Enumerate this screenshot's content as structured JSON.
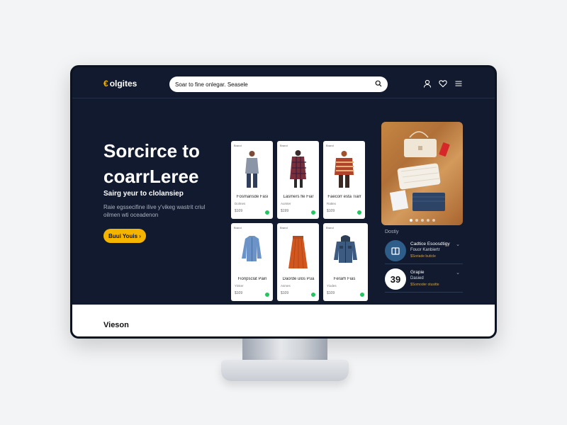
{
  "header": {
    "logo_mark": "€",
    "logo_text": "olgites",
    "search_value": "Soar to fine onlegar.  Seasele"
  },
  "hero": {
    "title_line1": "Sorcirce to",
    "title_line2": "coarrLeree",
    "subtitle": "Sairg yeur to clolansiep",
    "description": "Raie egssecifine ilive y'vikeg wastrit criul oilmen wti oceadenon",
    "cta_label": "Buui Youis ›"
  },
  "products": [
    {
      "tag": "Brand",
      "name": "Fosmansde Fasi",
      "sub": "Dolmes",
      "price": "$109",
      "icon": "grey-sweater-figure-icon"
    },
    {
      "tag": "Brand",
      "name": "Lasmers fle Fiar",
      "sub": "Aumter",
      "price": "$199",
      "icon": "plaid-dress-figure-icon"
    },
    {
      "tag": "Brand",
      "name": "Faecorr esta Tiarr",
      "sub": "Rattex",
      "price": "$109",
      "icon": "striped-sweater-figure-icon"
    },
    {
      "tag": "Brand",
      "name": "Fionpsclat Pain",
      "sub": "Yinker",
      "price": "$109",
      "icon": "blue-shirt-icon"
    },
    {
      "tag": "Brand",
      "name": "Daorde ulos Pua",
      "sub": "Asmes",
      "price": "$109",
      "icon": "orange-skirt-icon"
    },
    {
      "tag": "Brand",
      "name": "Ferarh Fias",
      "sub": "Yiodes",
      "price": "$109",
      "icon": "denim-jacket-icon"
    }
  ],
  "side": {
    "label": "Dostiy",
    "items": [
      {
        "avatar": "",
        "avatar_icon": "package-icon",
        "line1": "Cadtice Esoosdtigy",
        "line2": "Fouor Kanbiertr",
        "line3": "$Soriade buticle"
      },
      {
        "avatar": "39",
        "avatar_icon": "",
        "line1": "Grapie",
        "line2": "Dasied",
        "line3": "$Somoder otusitte"
      }
    ]
  },
  "bottom": {
    "title": "Vieson"
  },
  "colors": {
    "accent": "#f5b400",
    "navy": "#111a2e",
    "success": "#22c55e"
  }
}
